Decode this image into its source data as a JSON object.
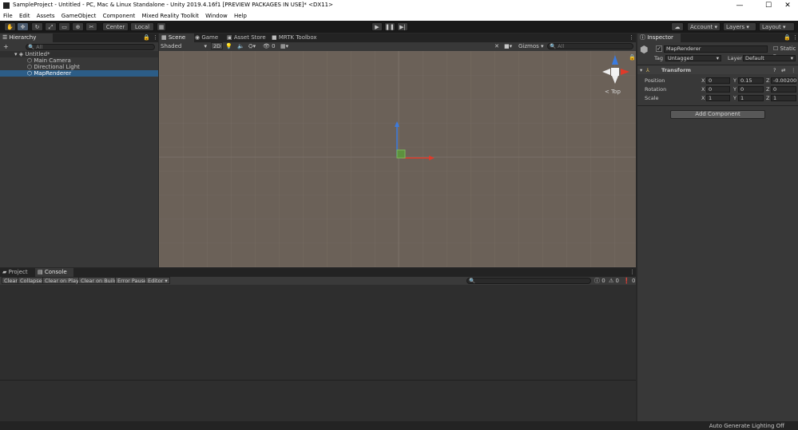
{
  "window": {
    "title": "SampleProject - Untitled - PC, Mac & Linux Standalone - Unity 2019.4.16f1 [PREVIEW PACKAGES IN USE]* <DX11>",
    "minimize": "—",
    "maximize": "☐",
    "close": "✕"
  },
  "menu": [
    "File",
    "Edit",
    "Assets",
    "GameObject",
    "Component",
    "Mixed Reality Toolkit",
    "Window",
    "Help"
  ],
  "toolbar": {
    "pivot_center": "Center",
    "pivot_local": "Local",
    "account": "Account",
    "layers": "Layers",
    "layout": "Layout"
  },
  "hierarchy": {
    "tab": "Hierarchy",
    "add": "+",
    "search_placeholder": "All",
    "scene": "Untitled*",
    "items": [
      "Main Camera",
      "Directional Light",
      "MapRenderer"
    ]
  },
  "scene": {
    "tabs": [
      "Scene",
      "Game",
      "Asset Store",
      "MRTK Toolbox"
    ],
    "shading": "Shaded",
    "mode_2d": "2D",
    "fx_count": "0",
    "gizmos": "Gizmos",
    "search_placeholder": "All",
    "orientation": "< Top"
  },
  "inspector": {
    "tab": "Inspector",
    "object_name": "MapRenderer",
    "static_label": "Static",
    "tag_label": "Tag",
    "tag_value": "Untagged",
    "layer_label": "Layer",
    "layer_value": "Default",
    "component_title": "Transform",
    "rows": [
      {
        "label": "Position",
        "x": "0",
        "y": "0.15",
        "z": "-0.00200"
      },
      {
        "label": "Rotation",
        "x": "0",
        "y": "0",
        "z": "0"
      },
      {
        "label": "Scale",
        "x": "1",
        "y": "1",
        "z": "1"
      }
    ],
    "add_component": "Add Component"
  },
  "bottom": {
    "tabs": [
      "Project",
      "Console"
    ],
    "buttons": [
      "Clear",
      "Collapse",
      "Clear on Play",
      "Clear on Build",
      "Error Pause",
      "Editor"
    ],
    "error_count": "0",
    "warning_count": "0",
    "info_count": "0"
  },
  "status": {
    "text": "Auto Generate Lighting Off"
  },
  "colors": {
    "selection": "#2c5d87",
    "scene_bg": "#6b6158",
    "axis_x": "#e03a2a",
    "axis_y": "#3b7be0",
    "axis_z": "#5a9a3a"
  }
}
